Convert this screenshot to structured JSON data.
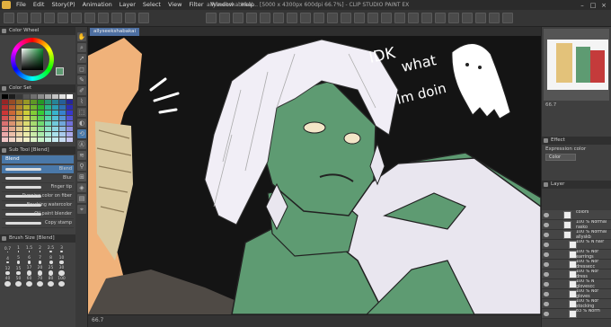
{
  "menu": [
    "File",
    "Edit",
    "Story(P)",
    "Animation",
    "Layer",
    "Select",
    "View",
    "Filter",
    "Window",
    "Help"
  ],
  "doc_title": "allyseekshabakai... [5000 x 4300px 600dpi 66.7%] - CLIP STUDIO PAINT EX",
  "canvas_tab": "allyseekshabakai",
  "panels": {
    "color_wheel": "Color Wheel",
    "color_set": "Color Set",
    "sub_tool": "Sub Tool [Blend]",
    "brush_size": "Brush Size [Blend]",
    "layer": "Layer",
    "effect": "Effect",
    "expression_color": "Expression color",
    "color_mode": "Color"
  },
  "subtool_group": "Blend",
  "brushes": [
    "Blend",
    "Blur",
    "Finger tip",
    "Running color on fiber",
    "Brushing watercolor",
    "Oil paint blender",
    "Copy stamp"
  ],
  "brush_sizes": [
    "0.7",
    "1",
    "1.5",
    "2",
    "2.5",
    "3",
    "4",
    "5",
    "6",
    "7",
    "8",
    "10",
    "12",
    "15",
    "17",
    "20",
    "25",
    "30",
    "40",
    "50",
    "60",
    "70",
    "80",
    "100"
  ],
  "status_zoom": "66.7",
  "nav_zoom": "66.7",
  "layers": [
    {
      "name": "colors",
      "indent": 1
    },
    {
      "name": "100 % Normal rasko",
      "indent": 1
    },
    {
      "name": "100 % Normal allyskb",
      "indent": 1
    },
    {
      "name": "100 % N hair",
      "indent": 2
    },
    {
      "name": "100 % Nor earrings",
      "indent": 2
    },
    {
      "name": "100 % Nor dressecc",
      "indent": 2
    },
    {
      "name": "100 % Nor dress",
      "indent": 2
    },
    {
      "name": "100 % N glovescc",
      "indent": 2
    },
    {
      "name": "100 % Nor gloves",
      "indent": 2
    },
    {
      "name": "100 % Nor stocking",
      "indent": 2
    },
    {
      "name": "83 % Norm",
      "indent": 2
    }
  ],
  "doodle_text": [
    "IDK",
    "what",
    "Im doin"
  ],
  "colors": {
    "accent": "#4a78a8",
    "bg": "#3a3a3a",
    "skin": "#5e9b72",
    "hair": "#f1eef6",
    "canvas_bg": "#141414"
  }
}
